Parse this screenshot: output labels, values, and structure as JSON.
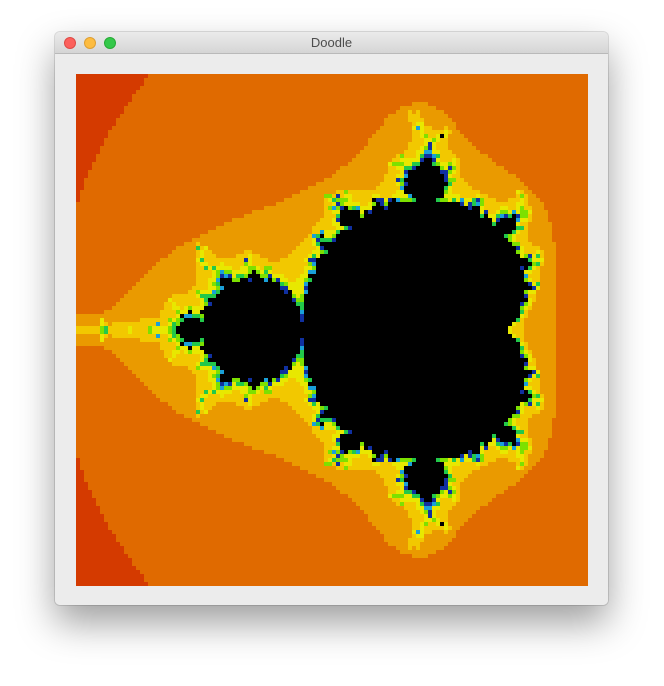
{
  "window": {
    "title": "Doodle"
  },
  "canvas": {
    "content": "mandelbrot-fractal",
    "resolution": 128,
    "max_iterations": 64,
    "center": [
      -0.6,
      0.0
    ],
    "span": 2.6,
    "palette": {
      "inside": "#000000",
      "outer": "#cc0000",
      "stops": [
        "#cc0000",
        "#d43a00",
        "#e06a00",
        "#ea9a00",
        "#f2c800",
        "#e8e800",
        "#7de000",
        "#22c84a",
        "#1aa0d8",
        "#1030a0"
      ]
    }
  }
}
